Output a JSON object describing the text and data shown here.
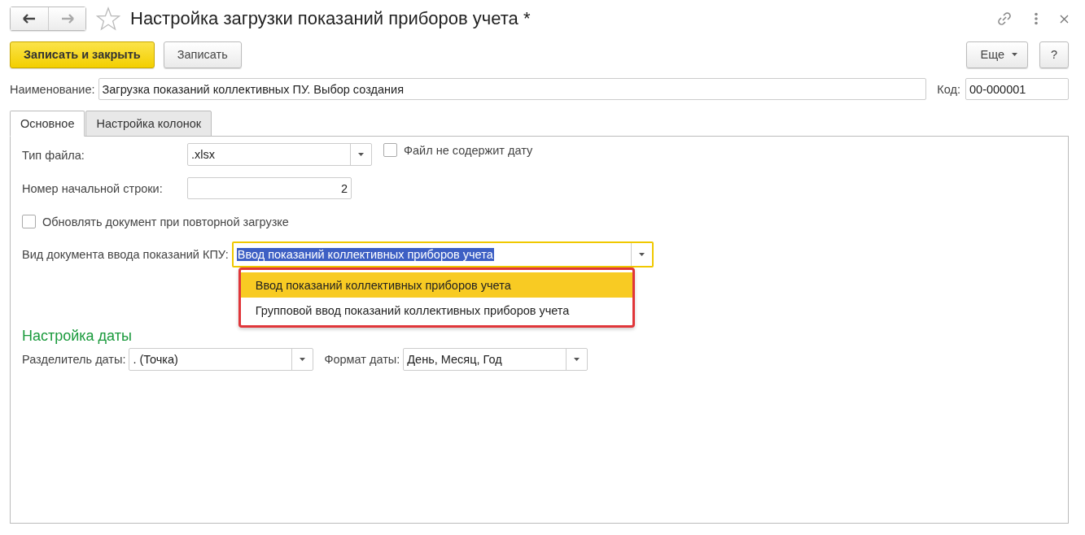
{
  "window": {
    "title": "Настройка загрузки показаний приборов учета *",
    "favorite": false
  },
  "nav": [
    {
      "kind": "back",
      "disabled": false
    },
    {
      "kind": "forward",
      "disabled": true
    }
  ],
  "toolbar": {
    "buttons": [
      {
        "label": "Записать и закрыть",
        "kind": "primary"
      },
      {
        "label": "Записать",
        "kind": "default"
      }
    ],
    "more": "Еще",
    "help": "?"
  },
  "name_field": {
    "label": "Наименование:",
    "value": "Загрузка показаний коллективных ПУ. Выбор создания"
  },
  "code_field": {
    "label": "Код:",
    "value": "00-000001"
  },
  "tabs": [
    {
      "label": "Основное",
      "selected": true
    },
    {
      "label": "Настройка колонок",
      "selected": false
    }
  ],
  "file_type": {
    "label": "Тип файла:",
    "value": ".xlsx"
  },
  "no_date": {
    "label": "Файл не содержит дату",
    "checked": false
  },
  "start_row": {
    "label": "Номер начальной строки:",
    "value": "2"
  },
  "update_doc": {
    "label": "Обновлять документ при повторной загрузке",
    "checked": false
  },
  "doc_kind": {
    "label": "Вид документа ввода показаний КПУ:",
    "value": "Ввод показаний коллективных приборов учета",
    "focused": true
  },
  "doc_kind_options": [
    {
      "label": "Ввод показаний коллективных приборов учета",
      "selected": true
    },
    {
      "label": "Групповой ввод показаний коллективных приборов учета",
      "selected": false
    }
  ],
  "date_section": {
    "title": "Настройка даты",
    "separator": {
      "label": "Разделитель даты:",
      "value": ". (Точка)"
    },
    "format": {
      "label": "Формат даты:",
      "value": "День, Месяц, Год"
    }
  }
}
